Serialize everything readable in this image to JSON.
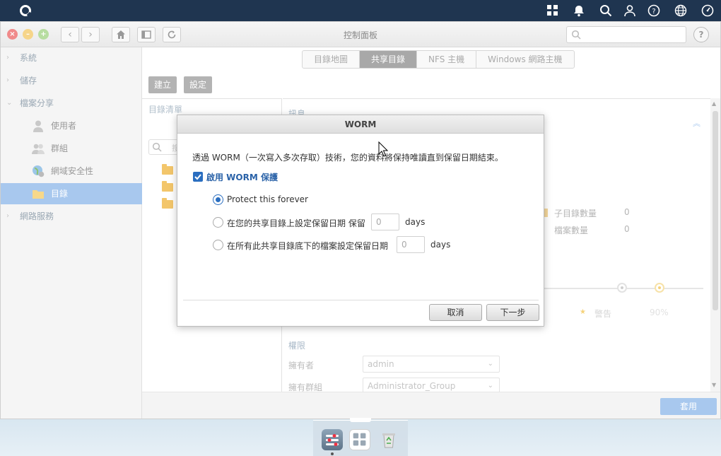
{
  "window": {
    "title": "控制面板"
  },
  "sidebar": {
    "items": [
      {
        "label": "系統"
      },
      {
        "label": "儲存"
      },
      {
        "label": "檔案分享"
      },
      {
        "label": "使用者"
      },
      {
        "label": "群組"
      },
      {
        "label": "網域安全性"
      },
      {
        "label": "目錄"
      },
      {
        "label": "網路服務"
      }
    ]
  },
  "tabs": [
    {
      "label": "目錄地圖"
    },
    {
      "label": "共享目錄"
    },
    {
      "label": "NFS 主機"
    },
    {
      "label": "Windows 網路主機"
    }
  ],
  "toolbar": {
    "create_label": "建立",
    "settings_label": "設定"
  },
  "list": {
    "title": "目錄清單",
    "search_placeholder": "搜"
  },
  "info": {
    "title": "訊息",
    "subdir_label": "子目錄數量",
    "subdir_value": "0",
    "file_label": "檔案數量",
    "file_value": "0",
    "warn_label": "警告",
    "warn_pct": "90%"
  },
  "permissions": {
    "title": "權限",
    "owner_label": "擁有者",
    "owner_value": "admin",
    "group_label": "擁有群組",
    "group_value": "Administrator_Group"
  },
  "footer": {
    "apply_label": "套用"
  },
  "modal": {
    "title": "WORM",
    "description": "透過 WORM（一次寫入多次存取）技術，您的資料將保持唯讀直到保留日期結束。",
    "enable_label": "啟用 WORM 保護",
    "option1": "Protect this forever",
    "option2": "在您的共享目錄上設定保留日期  保留",
    "option2_value": "0",
    "option2_unit": "days",
    "option3": "在所有此共享目錄底下的檔案設定保留日期",
    "option3_value": "0",
    "option3_unit": "days",
    "cancel_label": "取消",
    "next_label": "下一步"
  },
  "colors": {
    "accent": "#a8c8ee",
    "primary_blue": "#2a6ec0"
  }
}
